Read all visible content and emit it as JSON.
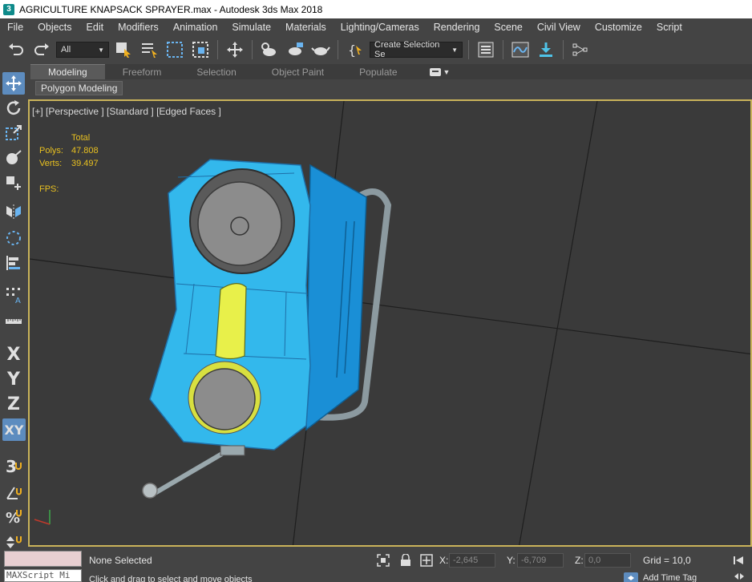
{
  "window": {
    "title": "AGRICULTURE KNAPSACK SPRAYER.max - Autodesk 3ds Max 2018",
    "app_icon_glyph": "3"
  },
  "menu": [
    "File",
    "Objects",
    "Edit",
    "Modifiers",
    "Animation",
    "Simulate",
    "Materials",
    "Lighting/Cameras",
    "Rendering",
    "Scene",
    "Civil View",
    "Customize",
    "Script"
  ],
  "toolbar": {
    "filter_value": "All",
    "selection_set_placeholder": "Create Selection Se"
  },
  "ribbon": {
    "tabs": [
      "Modeling",
      "Freeform",
      "Selection",
      "Object Paint",
      "Populate"
    ],
    "active_tab": "Modeling",
    "panel_label": "Polygon Modeling"
  },
  "left_toolbar": {
    "x_label": "X",
    "y_label": "Y",
    "z_label": "Z",
    "xy_label": "XY",
    "snap_label": "3"
  },
  "viewport": {
    "label": "[+] [Perspective ] [Standard ] [Edged Faces ]",
    "stats": {
      "header": "Total",
      "polys_label": "Polys:",
      "polys_value": "47.808",
      "verts_label": "Verts:",
      "verts_value": "39.497",
      "fps_label": "FPS:"
    },
    "colors": {
      "body": "#33b8ec",
      "edge": "#1e6fa8",
      "grey": "#8c8c8c",
      "yellow": "#e8f04a",
      "border": "#c9b35a"
    }
  },
  "status": {
    "selection": "None Selected",
    "prompt": "Click and drag to select and move objects",
    "maxscript_placeholder": "MAXScript Mi",
    "x_label": "X:",
    "x_value": "-2,645",
    "y_label": "Y:",
    "y_value": "-6,709",
    "z_label": "Z:",
    "z_value": "0,0",
    "grid": "Grid = 10,0",
    "add_time_tag": "Add Time Tag"
  }
}
